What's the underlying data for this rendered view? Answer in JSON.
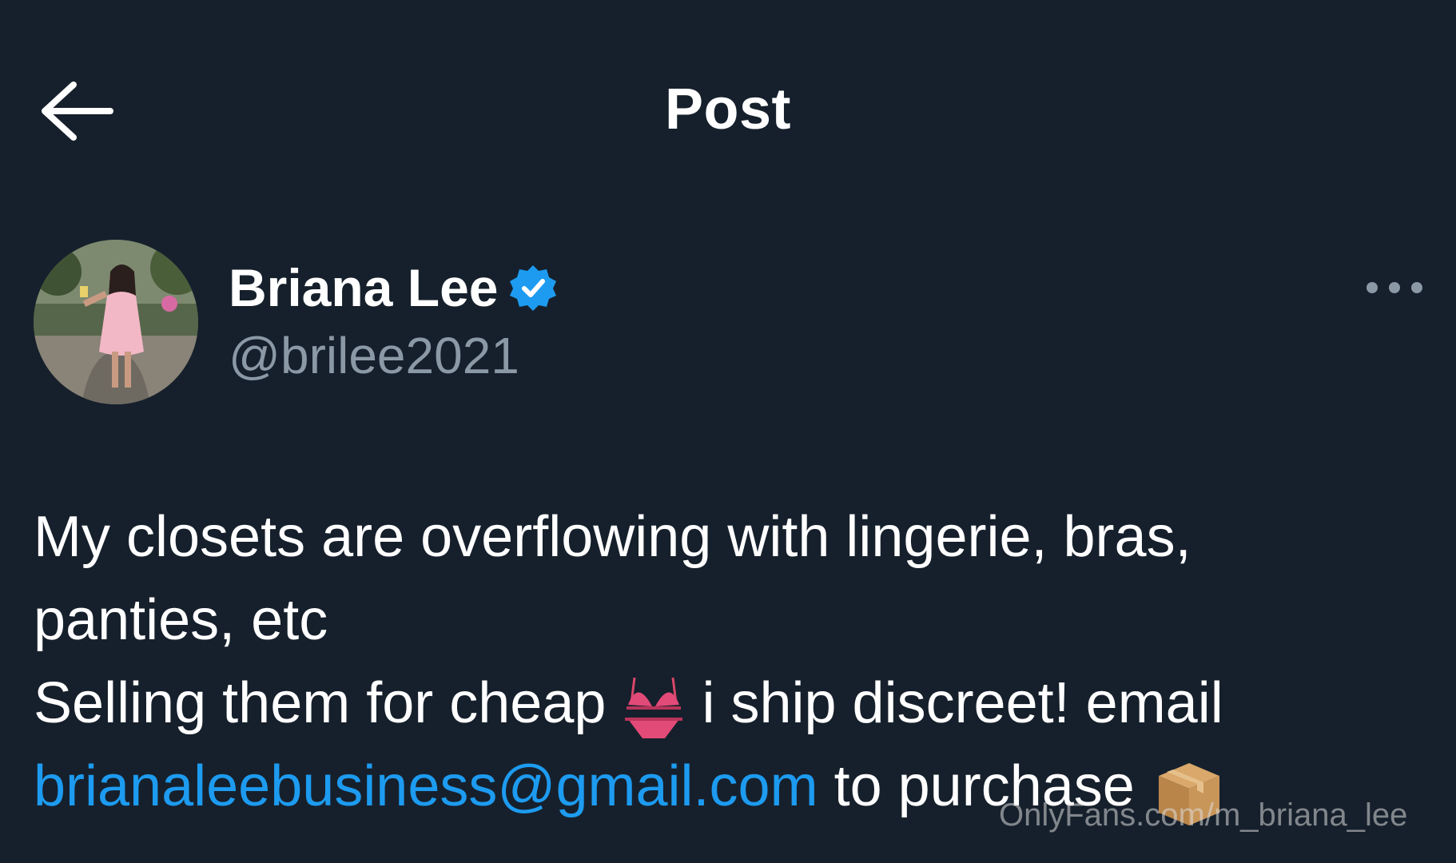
{
  "header": {
    "back_icon": "arrow-left-icon",
    "title": "Post"
  },
  "author": {
    "name": "Briana Lee",
    "handle": "@brilee2021",
    "verified": true,
    "verified_icon": "verified-badge-icon",
    "more_icon": "more-horizontal-icon"
  },
  "post": {
    "line1": "My closets are overflowing with lingerie, bras,",
    "line2": "panties, etc",
    "line3a": "Selling them for cheap",
    "line3b": "i ship discreet! email",
    "email": "brianaleebusiness@gmail.com",
    "line4b": "to purchase",
    "emoji_1": "bikini-icon",
    "emoji_2": "package-icon"
  },
  "watermark": "OnlyFans.com/m_briana_lee",
  "colors": {
    "background": "#16202c",
    "link": "#1d9bf0",
    "verified": "#1d9bf0",
    "secondary_text": "#8b98a5"
  }
}
